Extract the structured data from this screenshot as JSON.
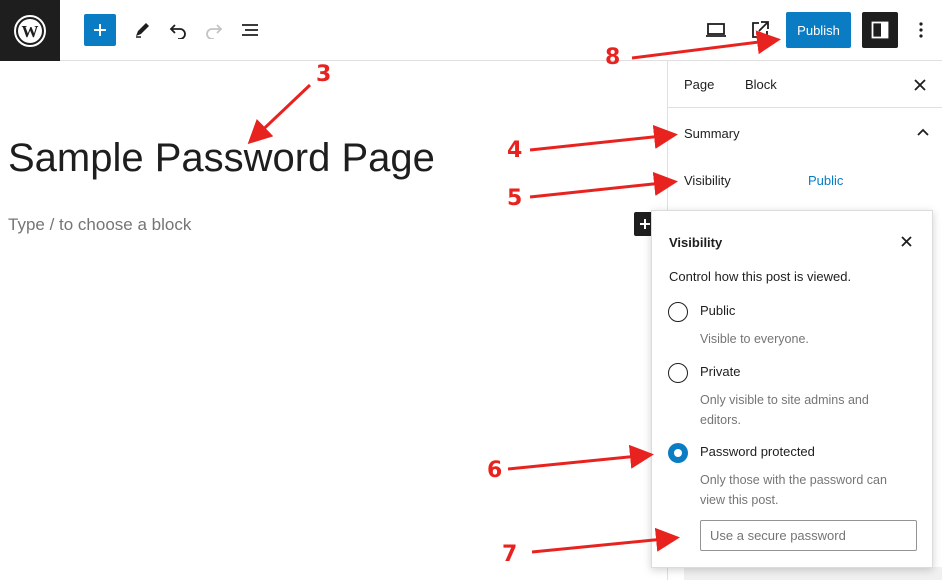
{
  "toolbar": {
    "publish_label": "Publish",
    "icons": [
      "wordpress-logo-icon",
      "plus-icon",
      "pencil-icon",
      "undo-icon",
      "redo-icon",
      "list-view-icon",
      "desktop-preview-icon",
      "external-link-icon",
      "sidebar-icon",
      "more-vertical-icon"
    ]
  },
  "editor": {
    "title": "Sample Password Page",
    "placeholder": "Type / to choose a block"
  },
  "sidebar": {
    "tabs": [
      {
        "label": "Page"
      },
      {
        "label": "Block"
      }
    ],
    "summary_label": "Summary",
    "visibility_label": "Visibility",
    "visibility_value": "Public"
  },
  "popover": {
    "title": "Visibility",
    "description": "Control how this post is viewed.",
    "options": [
      {
        "label": "Public",
        "help": "Visible to everyone.",
        "checked": false
      },
      {
        "label": "Private",
        "help": "Only visible to site admins and editors.",
        "checked": false
      },
      {
        "label": "Password protected",
        "help": "Only those with the password can view this post.",
        "checked": true
      }
    ],
    "password_placeholder": "Use a secure password"
  },
  "annotations": {
    "labels": [
      "3",
      "4",
      "5",
      "6",
      "7",
      "8"
    ],
    "color": "#e8231f"
  },
  "colors": {
    "accent": "#0a7cc4",
    "dark": "#1e1e1e"
  }
}
